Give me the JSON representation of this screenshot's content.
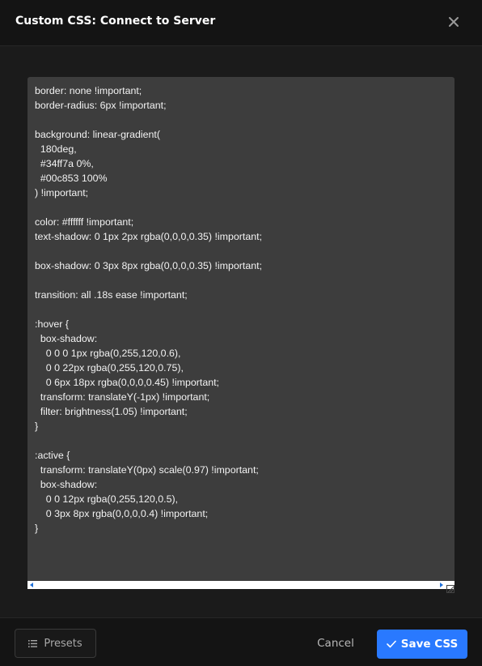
{
  "dialog": {
    "title": "Custom CSS: Connect to Server",
    "close_icon": "close-icon"
  },
  "editor": {
    "content": "border: none !important;\nborder-radius: 6px !important;\n\nbackground: linear-gradient(\n  180deg,\n  #34ff7a 0%,\n  #00c853 100%\n) !important;\n\ncolor: #ffffff !important;\ntext-shadow: 0 1px 2px rgba(0,0,0,0.35) !important;\n\nbox-shadow: 0 3px 8px rgba(0,0,0,0.35) !important;\n\ntransition: all .18s ease !important;\n\n:hover {\n  box-shadow:\n    0 0 0 1px rgba(0,255,120,0.6),\n    0 0 22px rgba(0,255,120,0.75),\n    0 6px 18px rgba(0,0,0,0.45) !important;\n  transform: translateY(-1px) !important;\n  filter: brightness(1.05) !important;\n}\n\n:active {\n  transform: translateY(0px) scale(0.97) !important;\n  box-shadow:\n    0 0 12px rgba(0,255,120,0.5),\n    0 3px 8px rgba(0,0,0,0.4) !important;\n}"
  },
  "footer": {
    "presets_label": "Presets",
    "presets_icon": "list-icon",
    "cancel_label": "Cancel",
    "save_label": "Save CSS",
    "save_icon": "check-icon"
  },
  "colors": {
    "accent": "#2979ff",
    "editor_bg": "#3d3d3d",
    "header_bg": "#141414"
  }
}
